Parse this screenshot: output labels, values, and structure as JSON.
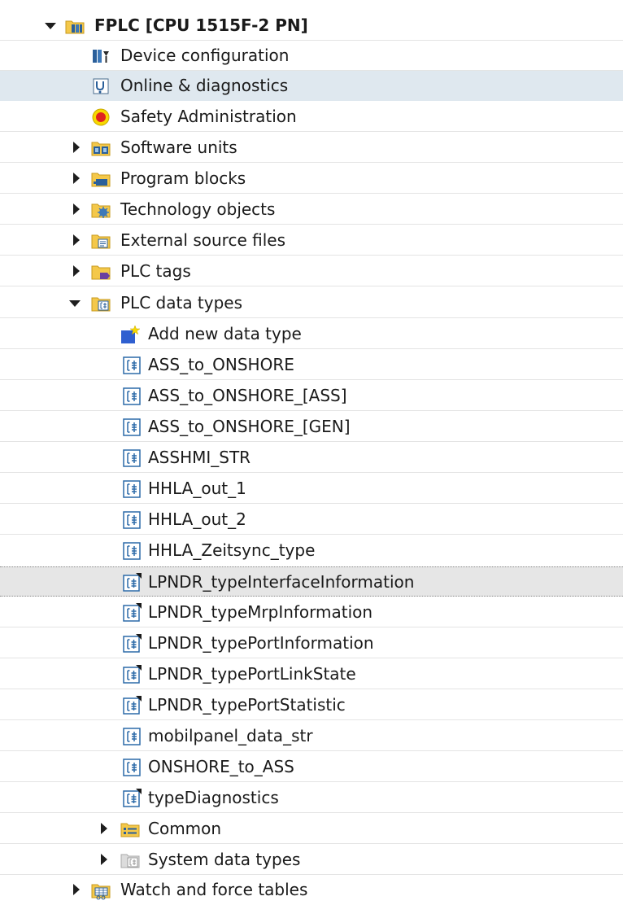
{
  "tree": {
    "root": {
      "label": "FPLC [CPU 1515F-2 PN]",
      "icon": "plc-cpu-icon",
      "expanded": true
    },
    "items": [
      {
        "label": "Device configuration",
        "icon": "device-configuration-icon"
      },
      {
        "label": "Online & diagnostics",
        "icon": "online-diagnostics-icon",
        "state": "hovered"
      },
      {
        "label": "Safety Administration",
        "icon": "safety-administration-icon"
      },
      {
        "label": "Software units",
        "icon": "software-units-folder-icon",
        "expanded": false
      },
      {
        "label": "Program blocks",
        "icon": "program-blocks-folder-icon",
        "expanded": false
      },
      {
        "label": "Technology objects",
        "icon": "technology-objects-folder-icon",
        "expanded": false
      },
      {
        "label": "External source files",
        "icon": "external-source-files-folder-icon",
        "expanded": false
      },
      {
        "label": "PLC tags",
        "icon": "plc-tags-folder-icon",
        "expanded": false
      },
      {
        "label": "PLC data types",
        "icon": "plc-data-types-folder-icon",
        "expanded": true
      }
    ],
    "data_types": [
      {
        "label": "Add new data type",
        "icon": "add-new-icon"
      },
      {
        "label": "ASS_to_ONSHORE",
        "icon": "udt-icon"
      },
      {
        "label": "ASS_to_ONSHORE_[ASS]",
        "icon": "udt-icon"
      },
      {
        "label": "ASS_to_ONSHORE_[GEN]",
        "icon": "udt-icon"
      },
      {
        "label": "ASSHMI_STR",
        "icon": "udt-icon"
      },
      {
        "label": "HHLA_out_1",
        "icon": "udt-icon"
      },
      {
        "label": "HHLA_out_2",
        "icon": "udt-icon"
      },
      {
        "label": "HHLA_Zeitsync_type",
        "icon": "udt-icon"
      },
      {
        "label": "LPNDR_typeInterfaceInformation",
        "icon": "udt-know-how-icon",
        "state": "selected"
      },
      {
        "label": "LPNDR_typeMrpInformation",
        "icon": "udt-know-how-icon"
      },
      {
        "label": "LPNDR_typePortInformation",
        "icon": "udt-know-how-icon"
      },
      {
        "label": "LPNDR_typePortLinkState",
        "icon": "udt-know-how-icon"
      },
      {
        "label": "LPNDR_typePortStatistic",
        "icon": "udt-know-how-icon"
      },
      {
        "label": "mobilpanel_data_str",
        "icon": "udt-icon"
      },
      {
        "label": "ONSHORE_to_ASS",
        "icon": "udt-icon"
      },
      {
        "label": "typeDiagnostics",
        "icon": "udt-know-how-icon"
      }
    ],
    "data_type_groups": [
      {
        "label": "Common",
        "icon": "common-folder-icon",
        "expanded": false
      },
      {
        "label": "System data types",
        "icon": "system-data-types-folder-icon",
        "expanded": false
      }
    ],
    "after": [
      {
        "label": "Watch and force tables",
        "icon": "watch-force-tables-folder-icon",
        "expanded": false
      }
    ]
  },
  "colors": {
    "hover_row": "#dfe8ef",
    "selected_row": "#e6e6e6",
    "folder_yellow": "#f4c84a",
    "folder_outline": "#c79a1e",
    "udt_blue": "#2c6aa8",
    "safety_red": "#e0231f",
    "safety_yellow": "#f7d800"
  }
}
